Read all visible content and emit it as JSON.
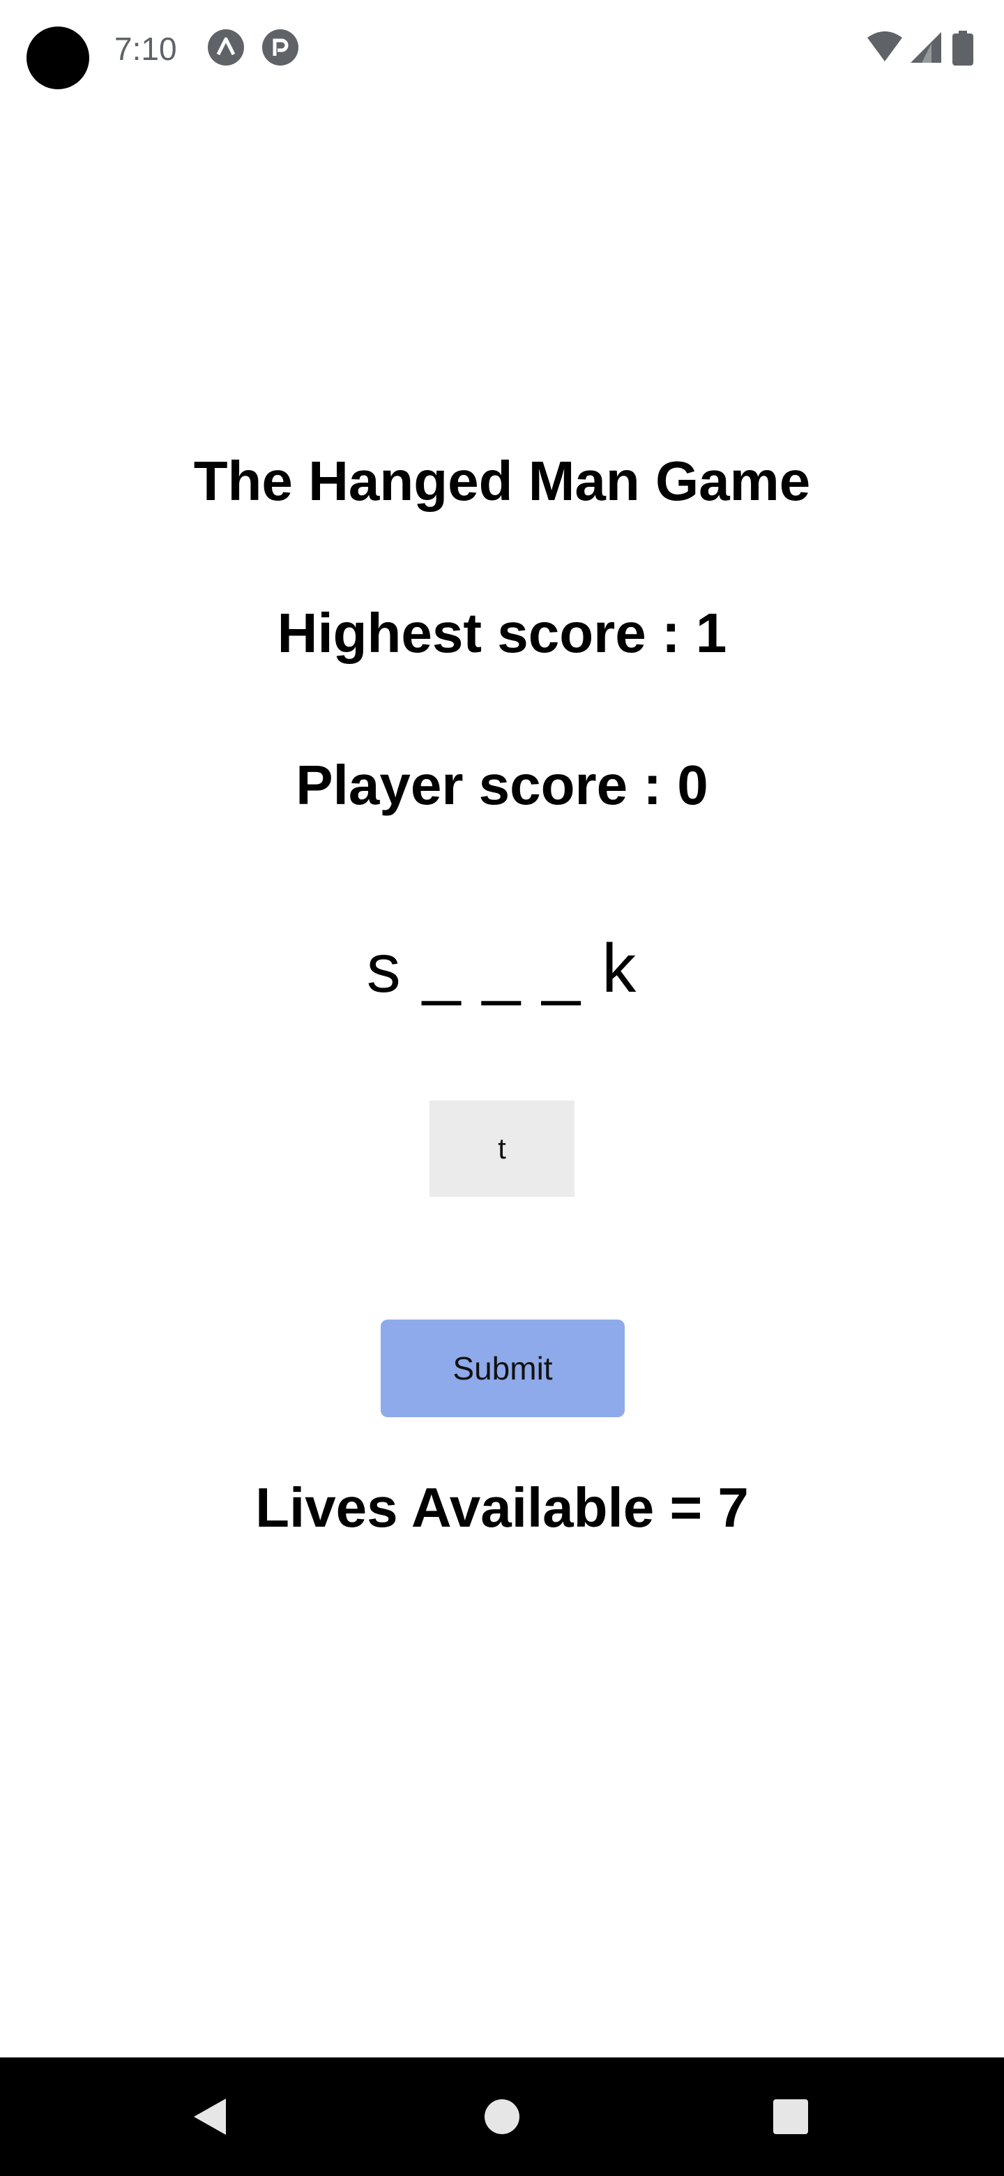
{
  "status_bar": {
    "time": "7:10",
    "icons": [
      "app-notification-icon",
      "app-notification-icon",
      "wifi-icon",
      "cellular-signal-icon",
      "battery-icon"
    ]
  },
  "game": {
    "title": "The Hanged Man Game",
    "highest_score": "Highest score : 1",
    "player_score": "Player score : 0",
    "word_display": "s _ _ _ k",
    "guess_input_value": "t",
    "submit_label": "Submit",
    "lives": "Lives Available = 7"
  },
  "nav_bar": {
    "icons": [
      "back-icon",
      "home-icon",
      "recents-icon"
    ]
  },
  "colors": {
    "submit_button": "#8eaaea",
    "input_background": "#ebebeb",
    "nav_background": "#000000",
    "status_icon": "#5f6368"
  }
}
